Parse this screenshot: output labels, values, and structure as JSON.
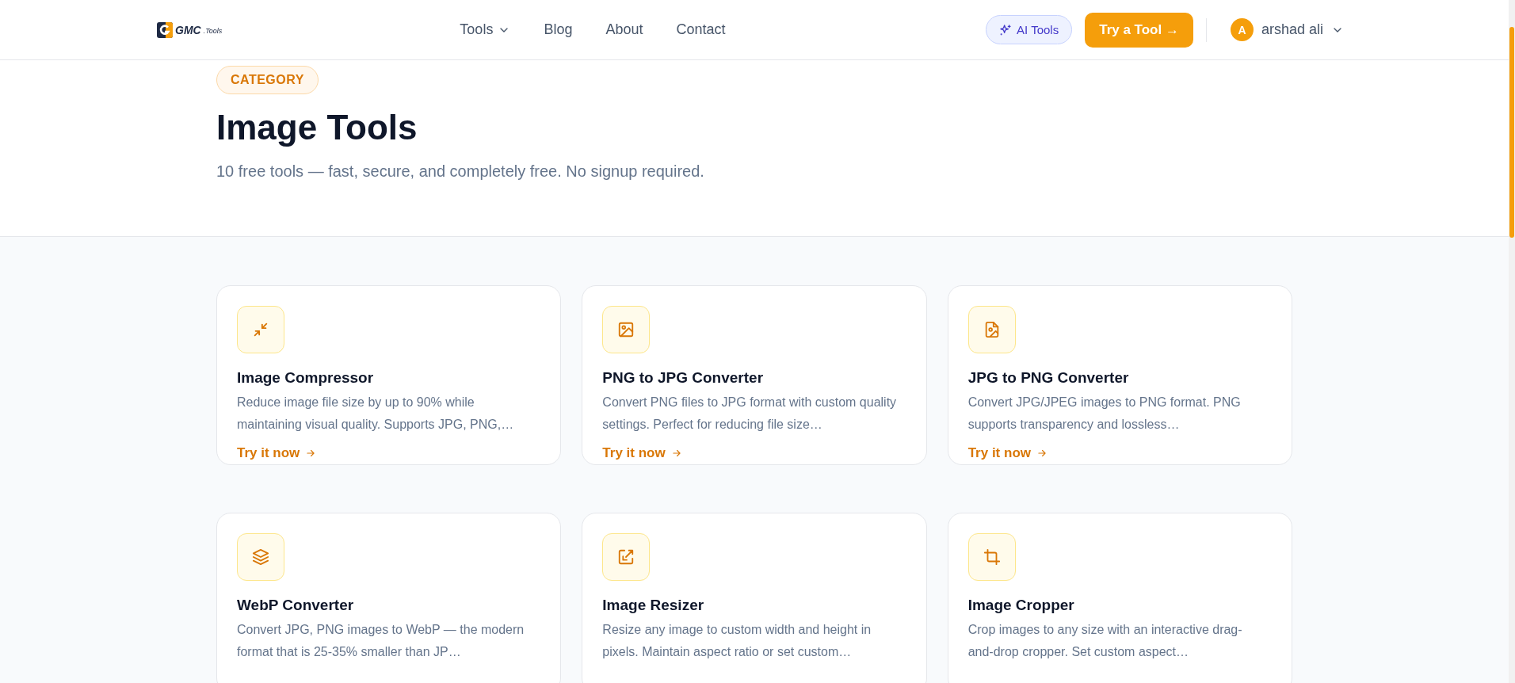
{
  "header": {
    "logo": {
      "name": "GMC",
      "suffix": ".Tools"
    },
    "nav": [
      {
        "label": "Tools",
        "dropdown": true
      },
      {
        "label": "Blog",
        "dropdown": false
      },
      {
        "label": "About",
        "dropdown": false
      },
      {
        "label": "Contact",
        "dropdown": false
      }
    ],
    "ai_button": "AI Tools",
    "cta_button": "Try a Tool →",
    "user": {
      "initial": "A",
      "name": "arshad ali",
      "dropdown": true
    }
  },
  "hero": {
    "badge": "CATEGORY",
    "title": "Image Tools",
    "subtitle": "10 free tools — fast, secure, and completely free. No signup required."
  },
  "tools": [
    {
      "title": "Image Compressor",
      "description": "Reduce image file size by up to 90% while maintaining visual quality. Supports JPG, PNG,…",
      "link": "Try it now"
    },
    {
      "title": "PNG to JPG Converter",
      "description": "Convert PNG files to JPG format with custom quality settings. Perfect for reducing file size…",
      "link": "Try it now"
    },
    {
      "title": "JPG to PNG Converter",
      "description": "Convert JPG/JPEG images to PNG format. PNG supports transparency and lossless…",
      "link": "Try it now"
    },
    {
      "title": "WebP Converter",
      "description": "Convert JPG, PNG images to WebP — the modern format that is 25-35% smaller than JP…"
    },
    {
      "title": "Image Resizer",
      "description": "Resize any image to custom width and height in pixels. Maintain aspect ratio or set custom…"
    },
    {
      "title": "Image Cropper",
      "description": "Crop images to any size with an interactive drag-and-drop cropper. Set custom aspect…"
    }
  ]
}
